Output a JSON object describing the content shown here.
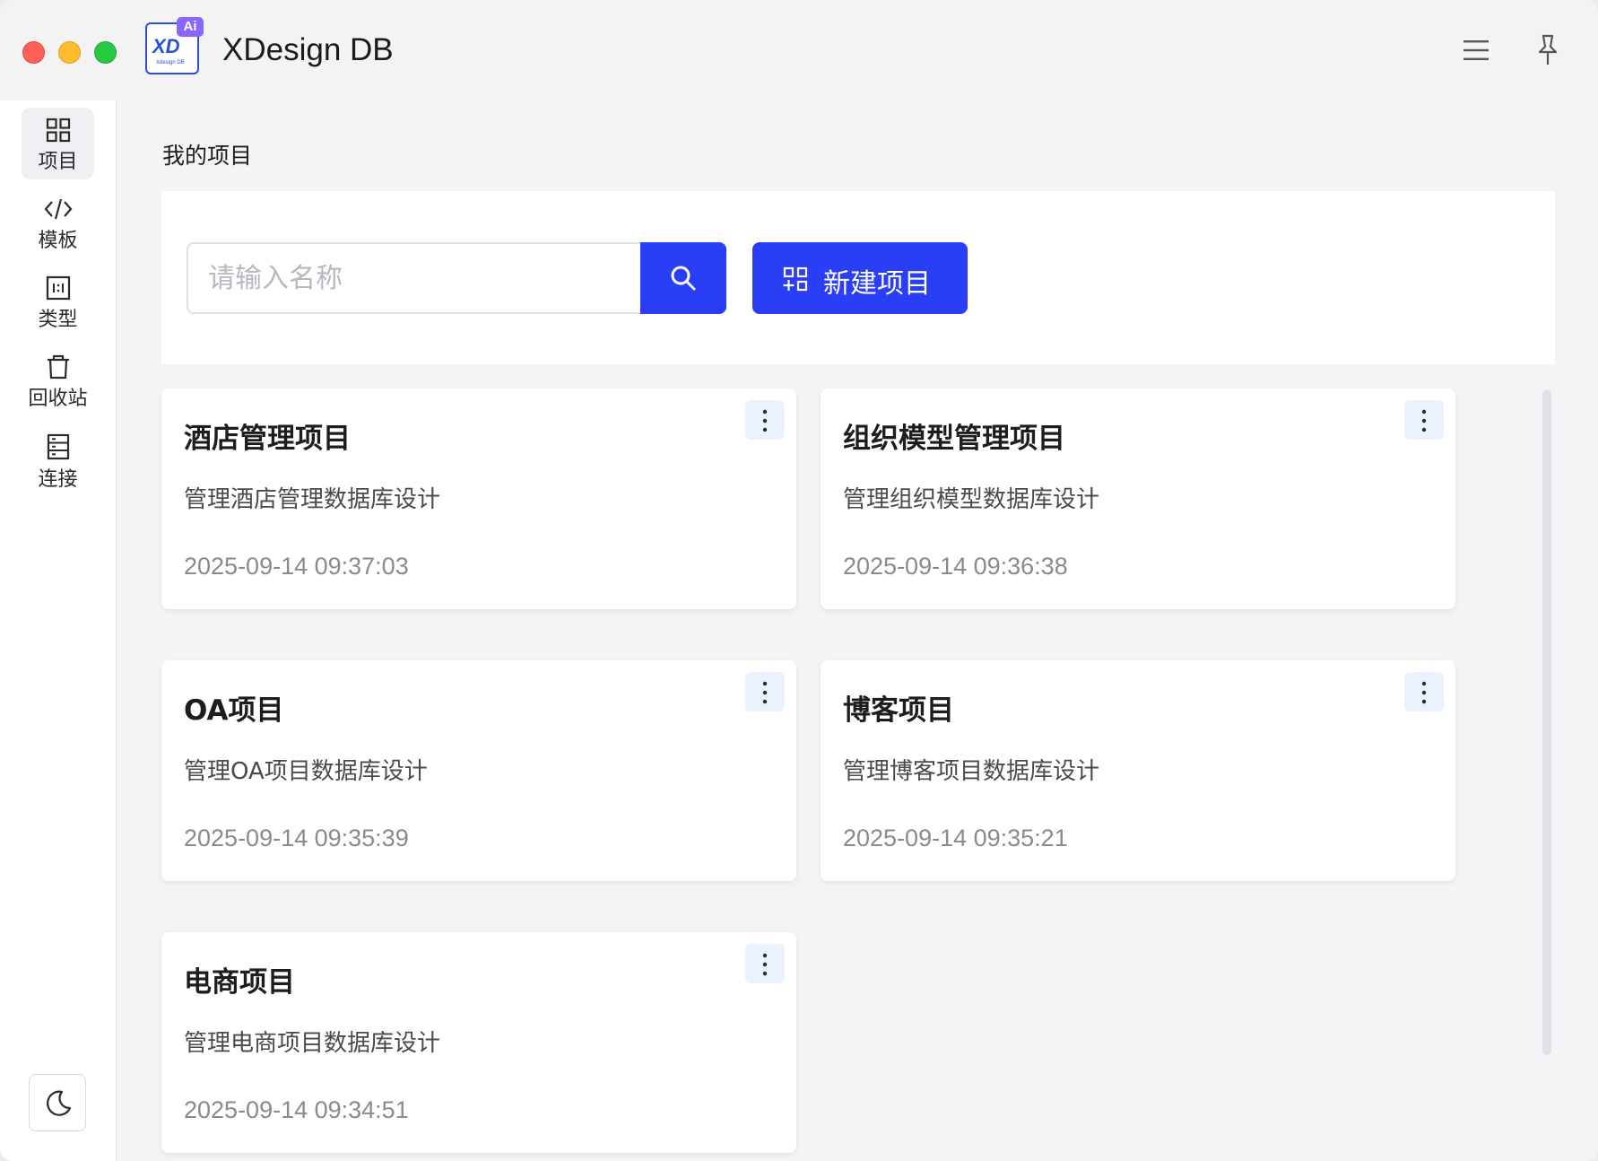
{
  "app": {
    "title": "XDesign DB",
    "logo_text": "XD",
    "logo_sub": "Xdesign DB",
    "logo_badge": "Ai"
  },
  "sidebar": {
    "items": [
      {
        "label": "项目",
        "icon": "grid-icon",
        "active": true
      },
      {
        "label": "模板",
        "icon": "code-icon",
        "active": false
      },
      {
        "label": "类型",
        "icon": "ratio-icon",
        "active": false
      },
      {
        "label": "回收站",
        "icon": "trash-icon",
        "active": false
      },
      {
        "label": "连接",
        "icon": "server-icon",
        "active": false
      }
    ],
    "theme_toggle_icon": "moon-icon"
  },
  "main": {
    "section_title": "我的项目",
    "search": {
      "placeholder": "请输入名称",
      "value": ""
    },
    "new_project_label": "新建项目",
    "projects": [
      {
        "title": "酒店管理项目",
        "description": "管理酒店管理数据库设计",
        "updated": "2025-09-14 09:37:03"
      },
      {
        "title": "组织模型管理项目",
        "description": "管理组织模型数据库设计",
        "updated": "2025-09-14 09:36:38"
      },
      {
        "title": "OA项目",
        "description": "管理OA项目数据库设计",
        "updated": "2025-09-14 09:35:39"
      },
      {
        "title": "博客项目",
        "description": "管理博客项目数据库设计",
        "updated": "2025-09-14 09:35:21"
      },
      {
        "title": "电商项目",
        "description": "管理电商项目数据库设计",
        "updated": "2025-09-14 09:34:51"
      }
    ]
  },
  "colors": {
    "primary": "#2a3ef5",
    "more_button_bg": "#eaf2fd",
    "window_bg": "#f3f4f6"
  }
}
